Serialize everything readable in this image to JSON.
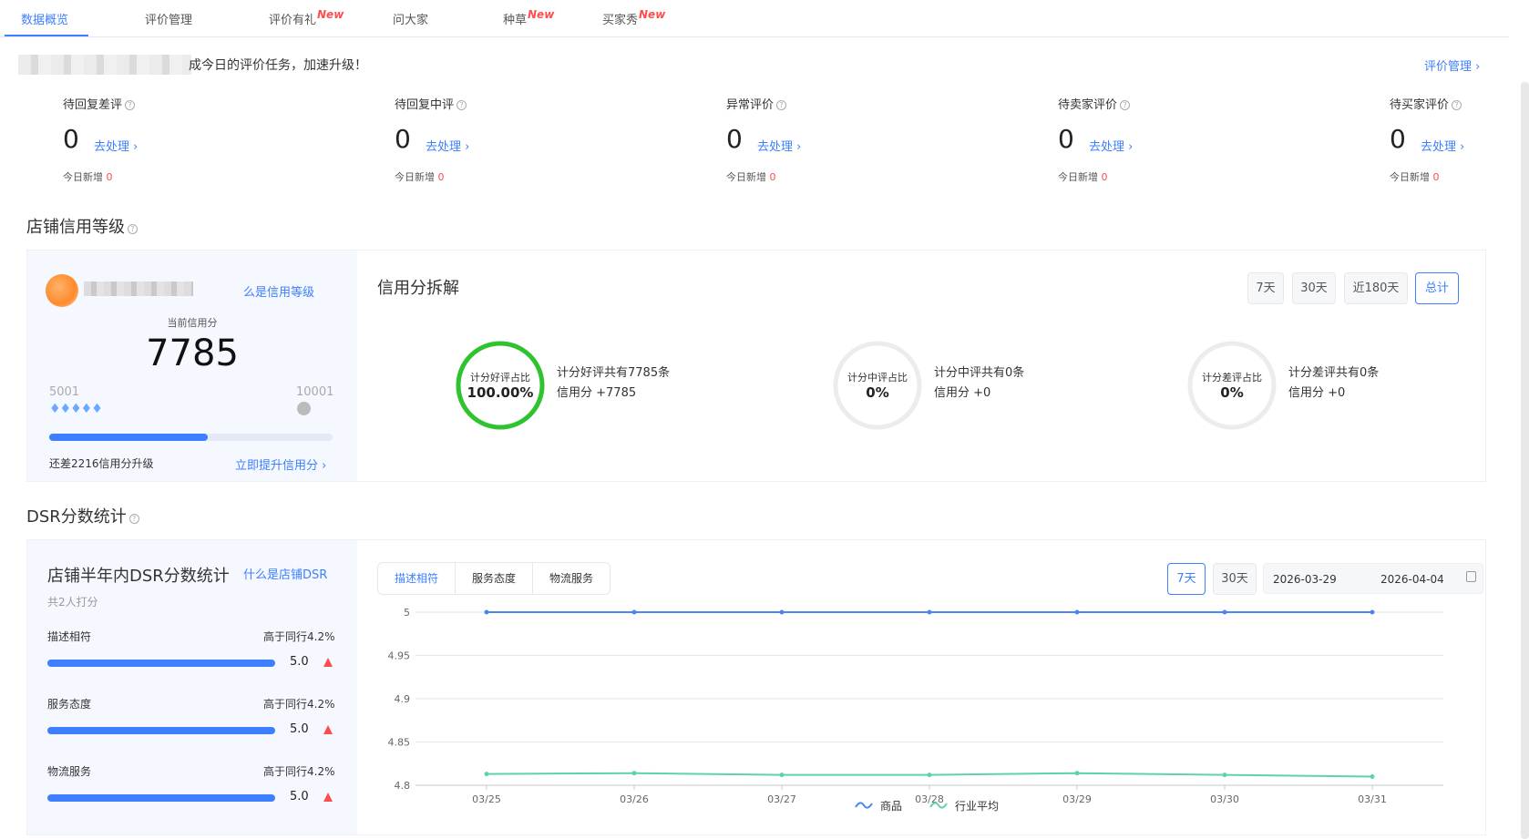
{
  "tabs": [
    {
      "label": "数据概览",
      "active": true,
      "badge": ""
    },
    {
      "label": "评价管理",
      "active": false,
      "badge": ""
    },
    {
      "label": "评价有礼",
      "active": false,
      "badge": "New"
    },
    {
      "label": "问大家",
      "active": false,
      "badge": ""
    },
    {
      "label": "种草",
      "active": false,
      "badge": "New"
    },
    {
      "label": "买家秀",
      "active": false,
      "badge": "New"
    }
  ],
  "banner": {
    "text": "成今日的评价任务，加速升级！",
    "manage_link": "评价管理 ›"
  },
  "stats": [
    {
      "title": "待回复差评",
      "value": "0",
      "action": "去处理 ›",
      "sub_label": "今日新增",
      "sub_value": "0"
    },
    {
      "title": "待回复中评",
      "value": "0",
      "action": "去处理 ›",
      "sub_label": "今日新增",
      "sub_value": "0"
    },
    {
      "title": "异常评价",
      "value": "0",
      "action": "去处理 ›",
      "sub_label": "今日新增",
      "sub_value": "0"
    },
    {
      "title": "待卖家评价",
      "value": "0",
      "action": "去处理 ›",
      "sub_label": "今日新增",
      "sub_value": "0"
    },
    {
      "title": "待买家评价",
      "value": "0",
      "action": "去处理 ›",
      "sub_label": "今日新增",
      "sub_value": "0"
    }
  ],
  "credit": {
    "section_title": "店铺信用等级",
    "what_link": "么是信用等级",
    "current_label": "当前信用分",
    "current_score": "7785",
    "range_min": "5001",
    "range_max": "10001",
    "progress": 0.56,
    "upgrade_text": "还差2216信用分升级",
    "improve_link": "立即提升信用分 ›",
    "breakdown_title": "信用分拆解",
    "periods": [
      "7天",
      "30天",
      "近180天",
      "总计"
    ],
    "active_period": "总计",
    "circles": [
      {
        "label": "计分好评占比",
        "value": "100.00%",
        "ratio": 1.0,
        "color": "#2fc42f",
        "desc1": "计分好评共有7785条",
        "desc2": "信用分 +7785"
      },
      {
        "label": "计分中评占比",
        "value": "0%",
        "ratio": 0,
        "color": "#e8e8e8",
        "desc1": "计分中评共有0条",
        "desc2": "信用分 +0"
      },
      {
        "label": "计分差评占比",
        "value": "0%",
        "ratio": 0,
        "color": "#e8e8e8",
        "desc1": "计分差评共有0条",
        "desc2": "信用分 +0"
      }
    ]
  },
  "dsr": {
    "section_title": "DSR分数统计",
    "card_title": "店铺半年内DSR分数统计",
    "what_link": "什么是店铺DSR",
    "raters": "共2人打分",
    "rows": [
      {
        "label": "描述相符",
        "compare": "高于同行4.2%",
        "score": "5.0"
      },
      {
        "label": "服务态度",
        "compare": "高于同行4.2%",
        "score": "5.0"
      },
      {
        "label": "物流服务",
        "compare": "高于同行4.2%",
        "score": "5.0"
      }
    ],
    "metric_tabs": [
      "描述相符",
      "服务态度",
      "物流服务"
    ],
    "active_metric": "描述相符",
    "ranges": [
      "7天",
      "30天"
    ],
    "active_range": "7天",
    "date_start": "2026-03-29",
    "date_end": "2026-04-04",
    "calendar_icon": "calendar-icon"
  },
  "chart_data": {
    "type": "line",
    "x": [
      "03/25",
      "03/26",
      "03/27",
      "03/28",
      "03/29",
      "03/30",
      "03/31"
    ],
    "ylim": [
      4.8,
      5
    ],
    "yticks": [
      "5",
      "4.95",
      "4.9",
      "4.85",
      "4.8"
    ],
    "series": [
      {
        "name": "商品",
        "color": "#4a86f0",
        "values": [
          5,
          5,
          5,
          5,
          5,
          5,
          5
        ]
      },
      {
        "name": "行业平均",
        "color": "#5fd3a8",
        "values": [
          4.813,
          4.814,
          4.812,
          4.812,
          4.814,
          4.812,
          4.81
        ]
      }
    ]
  }
}
